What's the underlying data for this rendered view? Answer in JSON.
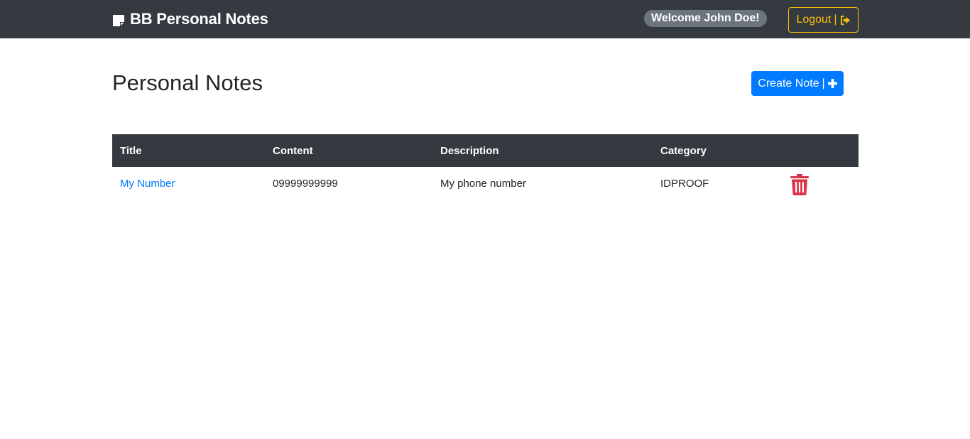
{
  "navbar": {
    "brand": "BB Personal Notes",
    "brand_icon": "sticky-note-icon",
    "welcome": "Welcome John Doe!",
    "logout_label": "Logout",
    "logout_separator": "|",
    "logout_icon": "sign-out-icon"
  },
  "main": {
    "title": "Personal Notes",
    "create_label": "Create Note",
    "create_separator": "|",
    "create_icon": "plus-icon"
  },
  "table": {
    "headers": [
      "Title",
      "Content",
      "Description",
      "Category"
    ],
    "rows": [
      {
        "title": "My Number",
        "content": "09999999999",
        "description": "My phone number",
        "category": "IDPROOF",
        "action_icon": "trash-icon"
      }
    ]
  },
  "colors": {
    "navbar_bg": "#343a40",
    "badge_bg": "#6c757d",
    "logout_accent": "#ffc107",
    "primary": "#007bff",
    "danger": "#dc3545"
  }
}
